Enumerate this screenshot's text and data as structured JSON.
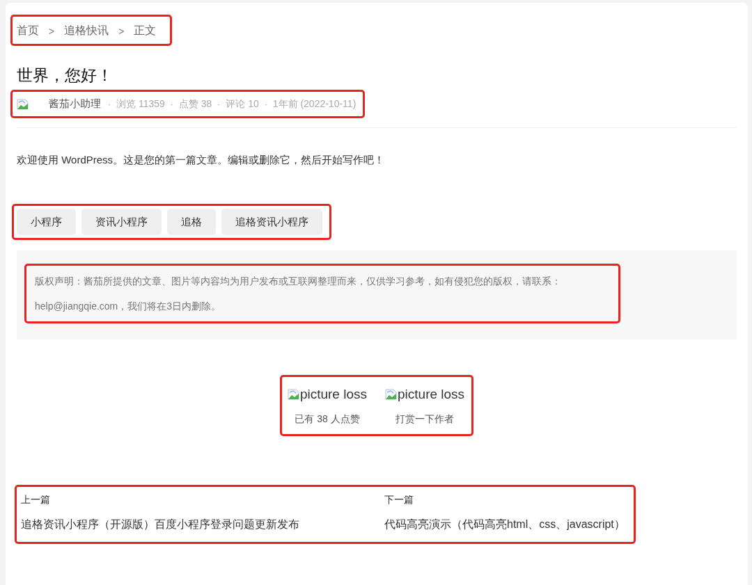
{
  "breadcrumb": {
    "highlighted": true,
    "items": [
      {
        "label": "首页"
      },
      {
        "label": "追格快讯"
      },
      {
        "label": "正文"
      }
    ],
    "separator": ">"
  },
  "article": {
    "title": "世界，您好！",
    "meta": {
      "highlighted": true,
      "author": "酱茄小助理",
      "dot": "·",
      "stats": [
        "浏览 11359",
        "点赞 38",
        "评论 10",
        "1年前 (2022-10-11)"
      ]
    },
    "body": "欢迎使用 WordPress。这是您的第一篇文章。编辑或删除它，然后开始写作吧！"
  },
  "tags": {
    "highlighted": true,
    "items": [
      "小程序",
      "资讯小程序",
      "追格",
      "追格资讯小程序"
    ]
  },
  "copyright": {
    "highlighted": true,
    "lines": [
      "版权声明：酱茄所提供的文章、图片等内容均为用户发布或互联网整理而来，仅供学习参考，如有侵犯您的版权，请联系：",
      "help@jiangqie.com，我们将在3日内删除。"
    ]
  },
  "actions": {
    "highlighted": true,
    "items": [
      {
        "alt": "picture loss",
        "caption": "已有 38 人点赞"
      },
      {
        "alt": "picture loss",
        "caption": "打赏一下作者"
      }
    ]
  },
  "post_nav": {
    "highlighted": true,
    "items": [
      {
        "label": "上一篇",
        "title": "追格资讯小程序（开源版）百度小程序登录问题更新发布"
      },
      {
        "label": "下一篇",
        "title": "代码高亮演示（代码高亮html、css、javascript）"
      }
    ]
  }
}
